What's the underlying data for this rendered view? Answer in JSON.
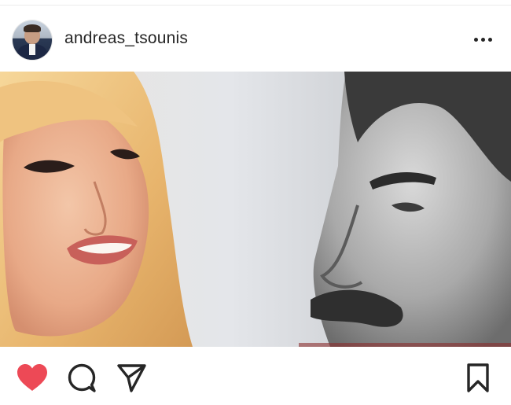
{
  "post": {
    "username": "andreas_tsounis",
    "avatar_icon": "profile-photo-icon",
    "more_icon": "more-options-icon"
  },
  "actions": {
    "like_icon": "heart-filled-icon",
    "comment_icon": "comment-icon",
    "share_icon": "send-icon",
    "save_icon": "bookmark-icon",
    "liked": true
  },
  "colors": {
    "text": "#262626",
    "like": "#ed4956",
    "border": "#ececec"
  }
}
